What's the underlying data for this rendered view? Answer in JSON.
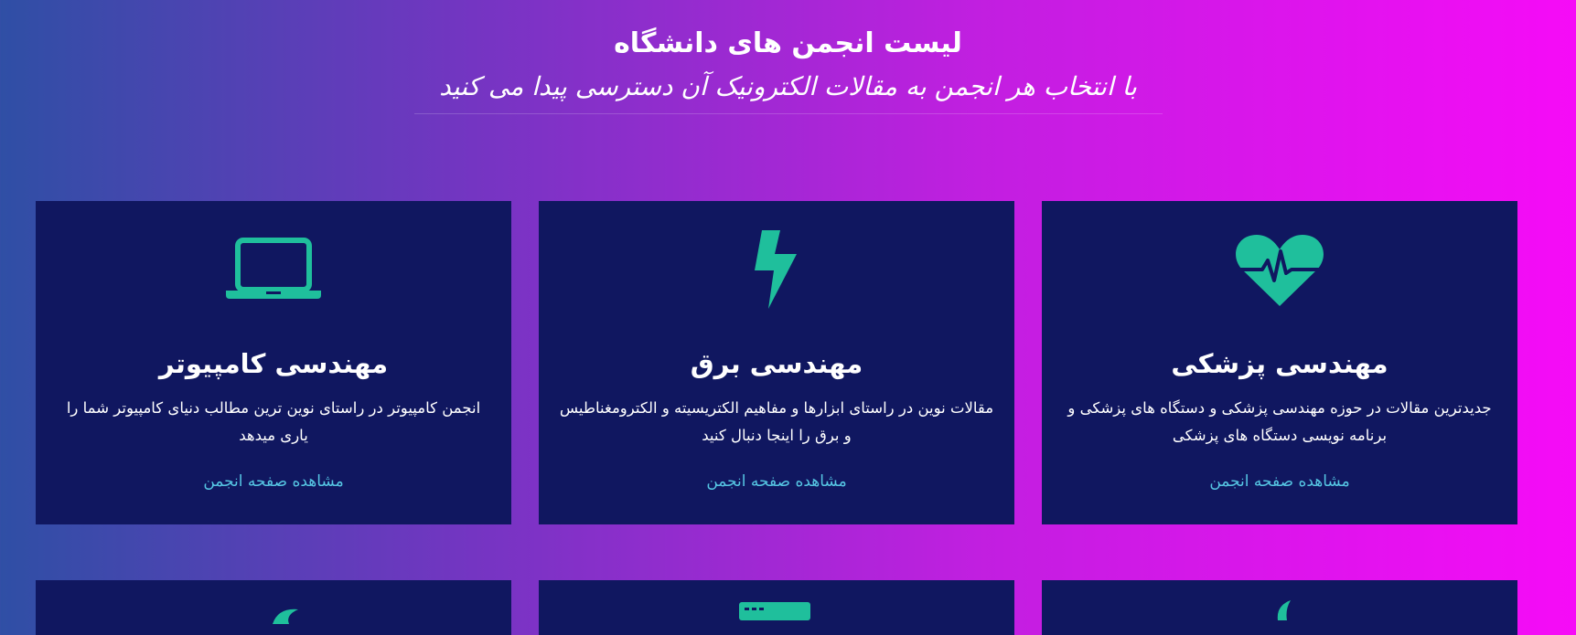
{
  "header": {
    "title": "لیست انجمن های دانشگاه",
    "subtitle": "با انتخاب هر انجمن به مقالات الکترونیک آن دسترسی پیدا می کنید"
  },
  "colors": {
    "card_background": "#101760",
    "icon_accent": "#1fbf9c",
    "link_color": "#56c7e4"
  },
  "cards": [
    {
      "icon": "laptop-icon",
      "title": "مهندسی کامپیوتر",
      "description": "انجمن کامپیوتر در راستای نوین ترین مطالب دنیای کامپیوتر شما را یاری میدهد",
      "link": "مشاهده صفحه انجمن"
    },
    {
      "icon": "lightning-bolt-icon",
      "title": "مهندسی برق",
      "description": "مقالات نوین در راستای ابزارها و مفاهیم الکتریسیته و الکترومغناطیس و برق را اینجا دنبال کنید",
      "link": "مشاهده صفحه انجمن"
    },
    {
      "icon": "heartbeat-icon",
      "title": "مهندسی پزشکی",
      "description": "جدیدترین مقالات در حوزه مهندسی پزشکی و دستگاه های پزشکی و برنامه نویسی دستگاه های پزشکی",
      "link": "مشاهده صفحه انجمن"
    }
  ]
}
